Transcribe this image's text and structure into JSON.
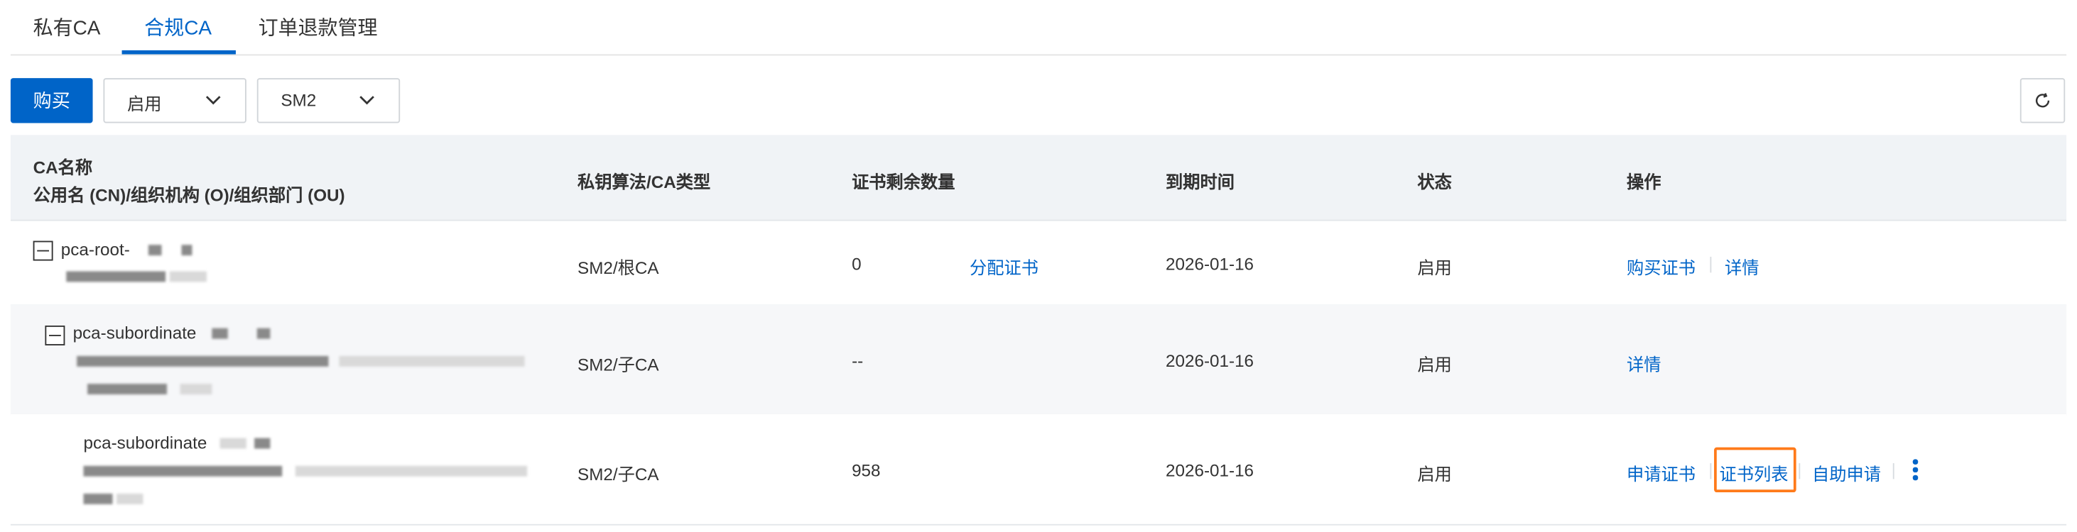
{
  "tabs": [
    {
      "label": "私有CA"
    },
    {
      "label": "合规CA"
    },
    {
      "label": "订单退款管理"
    }
  ],
  "active_tab": "合规CA",
  "toolbar": {
    "buy_label": "购买",
    "status_select": "启用",
    "algo_select": "SM2"
  },
  "table": {
    "headers": {
      "ca_name_line1": "CA名称",
      "ca_name_line2": "公用名 (CN)/组织机构 (O)/组织部门 (OU)",
      "algo": "私钥算法/CA类型",
      "remaining": "证书剩余数量",
      "expiry": "到期时间",
      "status": "状态",
      "actions": "操作"
    },
    "rows": [
      {
        "name": "pca-root-",
        "algo": "SM2/根CA",
        "remaining": "0",
        "assign": "分配证书",
        "expiry": "2026-01-16",
        "status": "启用",
        "actions": [
          "购买证书",
          "详情"
        ]
      },
      {
        "name": "pca-subordinate",
        "algo": "SM2/子CA",
        "remaining": "--",
        "expiry": "2026-01-16",
        "status": "启用",
        "actions": [
          "详情"
        ]
      },
      {
        "name": "pca-subordinate",
        "algo": "SM2/子CA",
        "remaining": "958",
        "expiry": "2026-01-16",
        "status": "启用",
        "actions": [
          "申请证书",
          "证书列表",
          "自助申请"
        ]
      }
    ]
  },
  "colors": {
    "primary": "#0064c8",
    "highlight": "#ff7a1a"
  }
}
